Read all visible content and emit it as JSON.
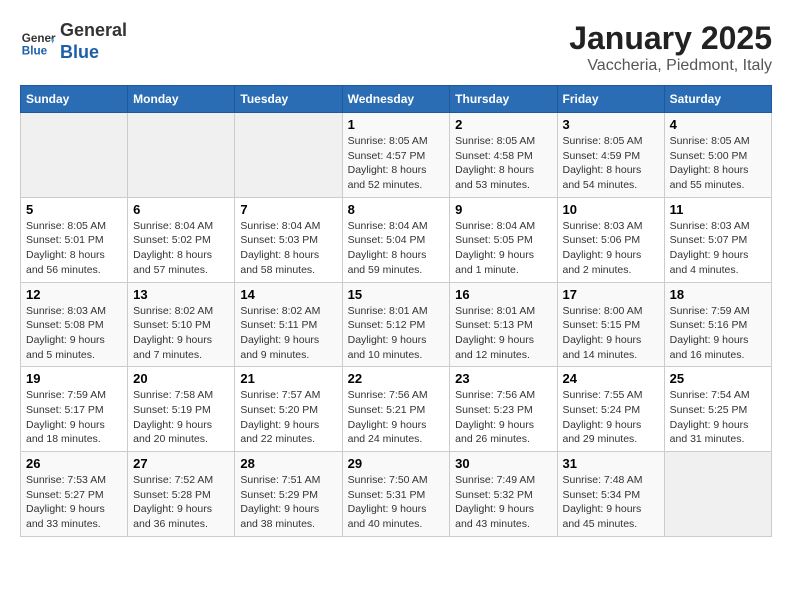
{
  "header": {
    "logo_line1": "General",
    "logo_line2": "Blue",
    "title": "January 2025",
    "subtitle": "Vaccheria, Piedmont, Italy"
  },
  "weekdays": [
    "Sunday",
    "Monday",
    "Tuesday",
    "Wednesday",
    "Thursday",
    "Friday",
    "Saturday"
  ],
  "weeks": [
    [
      {
        "day": "",
        "info": ""
      },
      {
        "day": "",
        "info": ""
      },
      {
        "day": "",
        "info": ""
      },
      {
        "day": "1",
        "info": "Sunrise: 8:05 AM\nSunset: 4:57 PM\nDaylight: 8 hours and 52 minutes."
      },
      {
        "day": "2",
        "info": "Sunrise: 8:05 AM\nSunset: 4:58 PM\nDaylight: 8 hours and 53 minutes."
      },
      {
        "day": "3",
        "info": "Sunrise: 8:05 AM\nSunset: 4:59 PM\nDaylight: 8 hours and 54 minutes."
      },
      {
        "day": "4",
        "info": "Sunrise: 8:05 AM\nSunset: 5:00 PM\nDaylight: 8 hours and 55 minutes."
      }
    ],
    [
      {
        "day": "5",
        "info": "Sunrise: 8:05 AM\nSunset: 5:01 PM\nDaylight: 8 hours and 56 minutes."
      },
      {
        "day": "6",
        "info": "Sunrise: 8:04 AM\nSunset: 5:02 PM\nDaylight: 8 hours and 57 minutes."
      },
      {
        "day": "7",
        "info": "Sunrise: 8:04 AM\nSunset: 5:03 PM\nDaylight: 8 hours and 58 minutes."
      },
      {
        "day": "8",
        "info": "Sunrise: 8:04 AM\nSunset: 5:04 PM\nDaylight: 8 hours and 59 minutes."
      },
      {
        "day": "9",
        "info": "Sunrise: 8:04 AM\nSunset: 5:05 PM\nDaylight: 9 hours and 1 minute."
      },
      {
        "day": "10",
        "info": "Sunrise: 8:03 AM\nSunset: 5:06 PM\nDaylight: 9 hours and 2 minutes."
      },
      {
        "day": "11",
        "info": "Sunrise: 8:03 AM\nSunset: 5:07 PM\nDaylight: 9 hours and 4 minutes."
      }
    ],
    [
      {
        "day": "12",
        "info": "Sunrise: 8:03 AM\nSunset: 5:08 PM\nDaylight: 9 hours and 5 minutes."
      },
      {
        "day": "13",
        "info": "Sunrise: 8:02 AM\nSunset: 5:10 PM\nDaylight: 9 hours and 7 minutes."
      },
      {
        "day": "14",
        "info": "Sunrise: 8:02 AM\nSunset: 5:11 PM\nDaylight: 9 hours and 9 minutes."
      },
      {
        "day": "15",
        "info": "Sunrise: 8:01 AM\nSunset: 5:12 PM\nDaylight: 9 hours and 10 minutes."
      },
      {
        "day": "16",
        "info": "Sunrise: 8:01 AM\nSunset: 5:13 PM\nDaylight: 9 hours and 12 minutes."
      },
      {
        "day": "17",
        "info": "Sunrise: 8:00 AM\nSunset: 5:15 PM\nDaylight: 9 hours and 14 minutes."
      },
      {
        "day": "18",
        "info": "Sunrise: 7:59 AM\nSunset: 5:16 PM\nDaylight: 9 hours and 16 minutes."
      }
    ],
    [
      {
        "day": "19",
        "info": "Sunrise: 7:59 AM\nSunset: 5:17 PM\nDaylight: 9 hours and 18 minutes."
      },
      {
        "day": "20",
        "info": "Sunrise: 7:58 AM\nSunset: 5:19 PM\nDaylight: 9 hours and 20 minutes."
      },
      {
        "day": "21",
        "info": "Sunrise: 7:57 AM\nSunset: 5:20 PM\nDaylight: 9 hours and 22 minutes."
      },
      {
        "day": "22",
        "info": "Sunrise: 7:56 AM\nSunset: 5:21 PM\nDaylight: 9 hours and 24 minutes."
      },
      {
        "day": "23",
        "info": "Sunrise: 7:56 AM\nSunset: 5:23 PM\nDaylight: 9 hours and 26 minutes."
      },
      {
        "day": "24",
        "info": "Sunrise: 7:55 AM\nSunset: 5:24 PM\nDaylight: 9 hours and 29 minutes."
      },
      {
        "day": "25",
        "info": "Sunrise: 7:54 AM\nSunset: 5:25 PM\nDaylight: 9 hours and 31 minutes."
      }
    ],
    [
      {
        "day": "26",
        "info": "Sunrise: 7:53 AM\nSunset: 5:27 PM\nDaylight: 9 hours and 33 minutes."
      },
      {
        "day": "27",
        "info": "Sunrise: 7:52 AM\nSunset: 5:28 PM\nDaylight: 9 hours and 36 minutes."
      },
      {
        "day": "28",
        "info": "Sunrise: 7:51 AM\nSunset: 5:29 PM\nDaylight: 9 hours and 38 minutes."
      },
      {
        "day": "29",
        "info": "Sunrise: 7:50 AM\nSunset: 5:31 PM\nDaylight: 9 hours and 40 minutes."
      },
      {
        "day": "30",
        "info": "Sunrise: 7:49 AM\nSunset: 5:32 PM\nDaylight: 9 hours and 43 minutes."
      },
      {
        "day": "31",
        "info": "Sunrise: 7:48 AM\nSunset: 5:34 PM\nDaylight: 9 hours and 45 minutes."
      },
      {
        "day": "",
        "info": ""
      }
    ]
  ]
}
